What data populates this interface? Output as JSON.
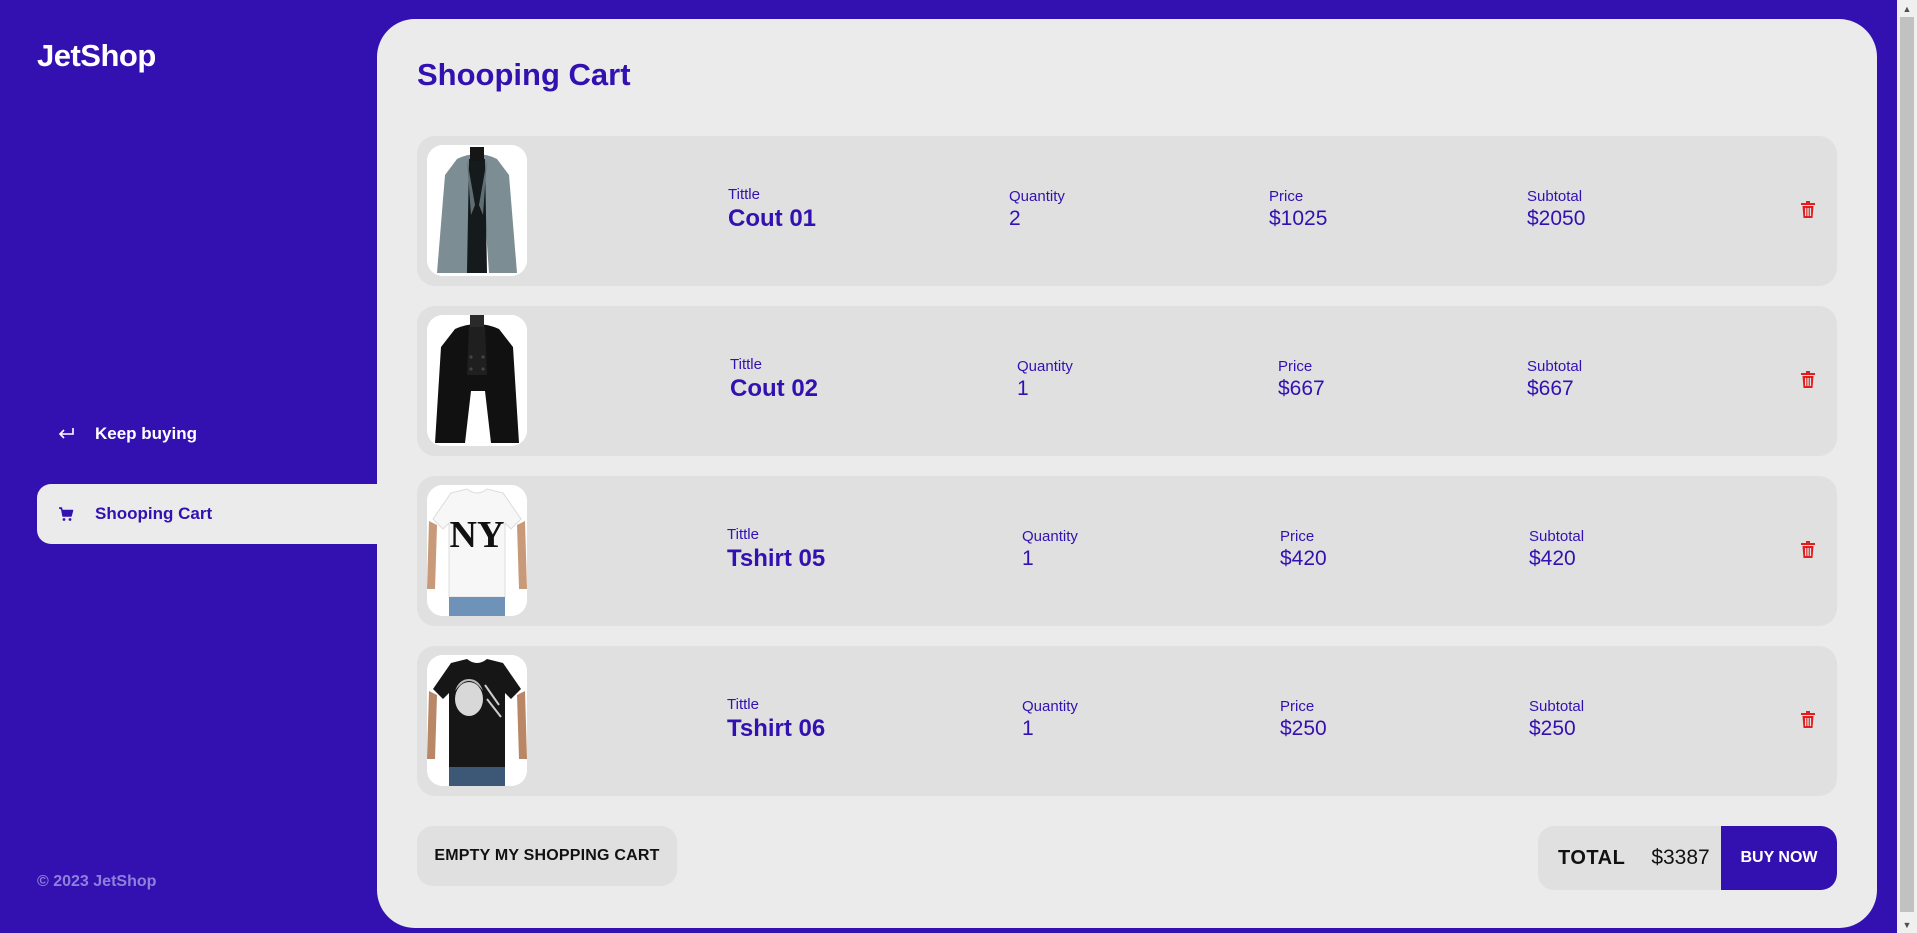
{
  "brand": {
    "logo": "JetShop",
    "footer": "© 2023 JetShop"
  },
  "nav": [
    {
      "label": "Keep buying",
      "icon": "return-arrow-icon"
    },
    {
      "label": "Shooping Cart",
      "icon": "cart-icon",
      "active": true
    }
  ],
  "page": {
    "title": "Shooping Cart"
  },
  "labels": {
    "title": "Tittle",
    "quantity": "Quantity",
    "price": "Price",
    "subtotal": "Subtotal"
  },
  "items": [
    {
      "title": "Cout 01",
      "quantity": "2",
      "price": "$1025",
      "subtotal": "$2050",
      "image": "grey-coat"
    },
    {
      "title": "Cout 02",
      "quantity": "1",
      "price": "$667",
      "subtotal": "$667",
      "image": "black-coat"
    },
    {
      "title": "Tshirt 05",
      "quantity": "1",
      "price": "$420",
      "subtotal": "$420",
      "image": "white-ny-tshirt"
    },
    {
      "title": "Tshirt 06",
      "quantity": "1",
      "price": "$250",
      "subtotal": "$250",
      "image": "black-print-tshirt"
    }
  ],
  "actions": {
    "empty_label": "EMPTY MY SHOPPING CART",
    "total_label": "TOTAL",
    "total_value": "$3387",
    "buy_label": "BUY NOW"
  },
  "colors": {
    "brand": "#3311b1",
    "panel": "#ebebeb",
    "card": "#e0e0e0",
    "delete": "#e11d1d"
  }
}
